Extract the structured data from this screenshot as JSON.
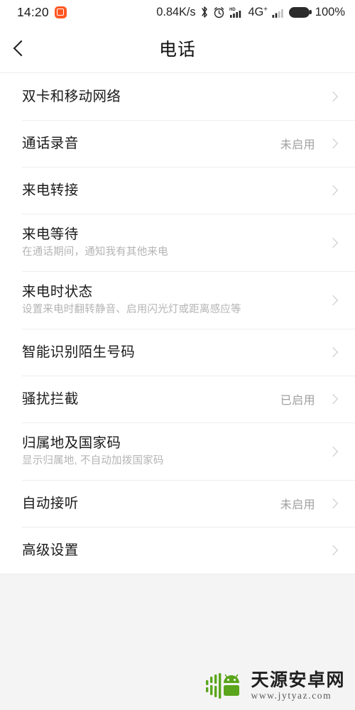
{
  "status_bar": {
    "time": "14:20",
    "app_icon": "orange-app-icon",
    "net_speed": "0.84K/s",
    "bluetooth_icon": "bluetooth-icon",
    "alarm_icon": "alarm-clock-icon",
    "hd_signal_icon": "hd-volte-signal-icon",
    "network_type": "4G",
    "network_type_sup": "+",
    "signal_icon": "signal-bars-icon",
    "battery_icon": "battery-full-icon",
    "battery_percent": "100%"
  },
  "header": {
    "back_icon": "back-chevron-icon",
    "title": "电话"
  },
  "settings": {
    "items": [
      {
        "title": "双卡和移动网络",
        "subtitle": "",
        "value": "",
        "chevron": "chevron-right-icon"
      },
      {
        "title": "通话录音",
        "subtitle": "",
        "value": "未启用",
        "chevron": "chevron-right-icon"
      },
      {
        "title": "来电转接",
        "subtitle": "",
        "value": "",
        "chevron": "chevron-right-icon"
      },
      {
        "title": "来电等待",
        "subtitle": "在通话期间，通知我有其他来电",
        "value": "",
        "chevron": "chevron-right-icon"
      },
      {
        "title": "来电时状态",
        "subtitle": "设置来电时翻转静音、启用闪光灯或距离感应等",
        "value": "",
        "chevron": "chevron-right-icon"
      },
      {
        "title": "智能识别陌生号码",
        "subtitle": "",
        "value": "",
        "chevron": "chevron-right-icon"
      },
      {
        "title": "骚扰拦截",
        "subtitle": "",
        "value": "已启用",
        "chevron": "chevron-right-icon"
      },
      {
        "title": "归属地及国家码",
        "subtitle": "显示归属地, 不自动加拨国家码",
        "value": "",
        "chevron": "chevron-right-icon"
      },
      {
        "title": "自动接听",
        "subtitle": "",
        "value": "未启用",
        "chevron": "chevron-right-icon"
      },
      {
        "title": "高级设置",
        "subtitle": "",
        "value": "",
        "chevron": "chevron-right-icon"
      }
    ]
  },
  "watermark": {
    "logo_icon": "android-robot-logo-icon",
    "name": "天源安卓网",
    "url": "www.jytyaz.com",
    "logo_color": "#5aa51b"
  },
  "colors": {
    "page_background": "#f4f4f4",
    "card_background": "#ffffff",
    "title_text": "#1a1a1a",
    "subtitle_text": "#b4b4b4",
    "value_text": "#a0a0a0",
    "divider": "#eeeeee",
    "accent_orange": "#ff5722"
  }
}
